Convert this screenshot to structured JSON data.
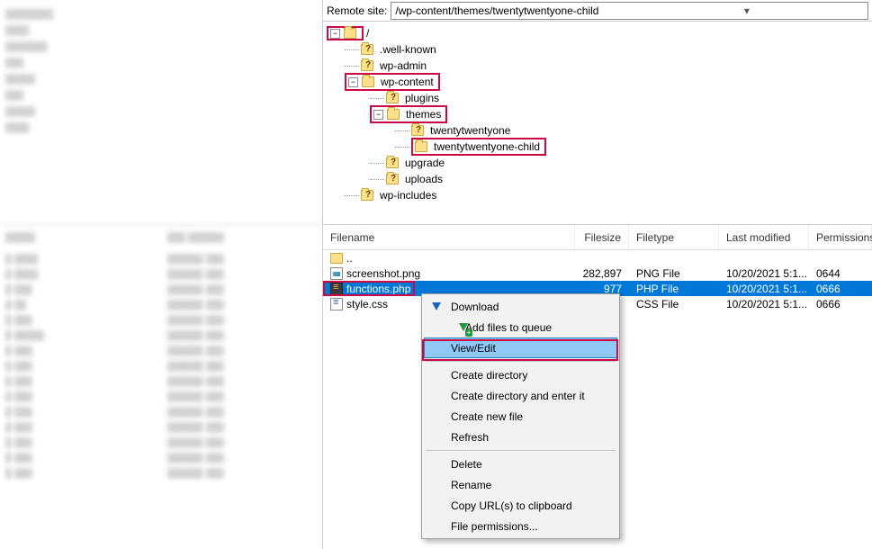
{
  "remote": {
    "label": "Remote site:",
    "path": "/wp-content/themes/twentytwentyone-child"
  },
  "tree": {
    "root": "/",
    "items": [
      ".well-known",
      "wp-admin",
      "wp-content",
      "plugins",
      "themes",
      "twentytwentyone",
      "twentytwentyone-child",
      "upgrade",
      "uploads",
      "wp-includes"
    ]
  },
  "list": {
    "headers": {
      "name": "Filename",
      "size": "Filesize",
      "type": "Filetype",
      "mod": "Last modified",
      "perm": "Permissions"
    },
    "rows": [
      {
        "name": "..",
        "size": "",
        "type": "",
        "mod": "",
        "perm": "",
        "icon": "updir"
      },
      {
        "name": "screenshot.png",
        "size": "282,897",
        "type": "PNG File",
        "mod": "10/20/2021 5:1...",
        "perm": "0644",
        "icon": "png"
      },
      {
        "name": "functions.php",
        "size": "977",
        "type": "PHP File",
        "mod": "10/20/2021 5:1...",
        "perm": "0666",
        "icon": "php",
        "selected": true
      },
      {
        "name": "style.css",
        "size": "",
        "type": "CSS File",
        "mod": "10/20/2021 5:1...",
        "perm": "0666",
        "icon": "css"
      }
    ]
  },
  "ctx": {
    "download": "Download",
    "addqueue": "Add files to queue",
    "viewedit": "View/Edit",
    "createdir": "Create directory",
    "createdirenter": "Create directory and enter it",
    "createfile": "Create new file",
    "refresh": "Refresh",
    "delete": "Delete",
    "rename": "Rename",
    "copyurl": "Copy URL(s) to clipboard",
    "fileperm": "File permissions..."
  }
}
